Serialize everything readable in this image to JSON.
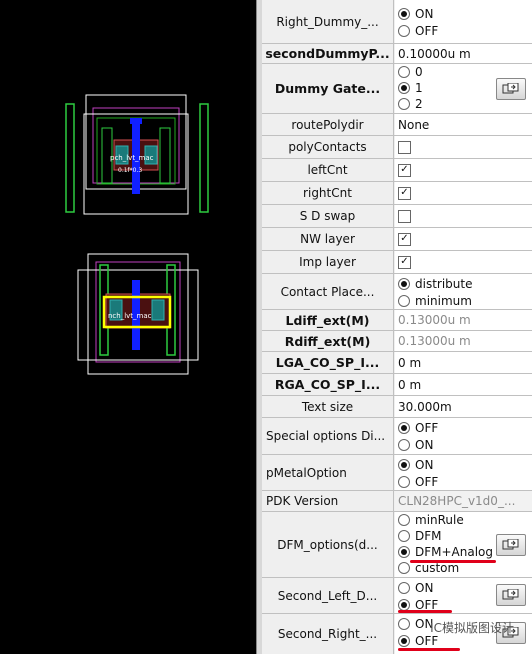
{
  "colors": {
    "layout_bg": "#000000",
    "panel_bg": "#efefef",
    "value_bg": "#ffffff",
    "annotation": "#e0001a"
  },
  "layout": {
    "top_cell_label": "pch_lvt_mac",
    "top_cell_sub": "0.1f*0.3",
    "bottom_cell_label": "nch_lvt_mac"
  },
  "panel": {
    "right_dummy": {
      "label": "Right_Dummy_...",
      "options": [
        "ON",
        "OFF"
      ],
      "selected": 0
    },
    "second_dummy_p": {
      "label": "secondDummyP...",
      "value": "0.10000u m"
    },
    "dummy_gate": {
      "label": "Dummy Gate...",
      "options": [
        "0",
        "1",
        "2"
      ],
      "selected": 1
    },
    "route_poly_dir": {
      "label": "routePolydir",
      "value": "None"
    },
    "poly_contacts": {
      "label": "polyContacts",
      "checked": false
    },
    "left_cnt": {
      "label": "leftCnt",
      "checked": true
    },
    "right_cnt": {
      "label": "rightCnt",
      "checked": true
    },
    "sd_swap": {
      "label": "S D swap",
      "checked": false
    },
    "nw_layer": {
      "label": "NW layer",
      "checked": true
    },
    "imp_layer": {
      "label": "Imp layer",
      "checked": true
    },
    "contact_place": {
      "label": "Contact Place...",
      "options": [
        "distribute",
        "minimum"
      ],
      "selected": 0
    },
    "ldiff_ext": {
      "label": "Ldiff_ext(M)",
      "value": "0.13000u m"
    },
    "rdiff_ext": {
      "label": "Rdiff_ext(M)",
      "value": "0.13000u m"
    },
    "lga_co_sp": {
      "label": "LGA_CO_SP_I...",
      "value": "0 m"
    },
    "rga_co_sp": {
      "label": "RGA_CO_SP_I...",
      "value": "0 m"
    },
    "text_size": {
      "label": "Text size",
      "value": "30.000m"
    },
    "special_options": {
      "label": "Special options Di...",
      "options": [
        "OFF",
        "ON"
      ],
      "selected": 0
    },
    "pmetal_option": {
      "label": "pMetalOption",
      "options": [
        "ON",
        "OFF"
      ],
      "selected": 0
    },
    "pdk_version": {
      "label": "PDK Version",
      "value": "CLN28HPC_v1d0_..."
    },
    "dfm_options": {
      "label": "DFM_options(d...",
      "options": [
        "minRule",
        "DFM",
        "DFM+Analog",
        "custom"
      ],
      "selected": 2
    },
    "second_left_d": {
      "label": "Second_Left_D...",
      "options": [
        "ON",
        "OFF"
      ],
      "selected": 1
    },
    "second_right": {
      "label": "Second_Right_...",
      "options": [
        "ON",
        "OFF"
      ],
      "selected": 1
    }
  },
  "watermark": "IC模拟版图设计"
}
